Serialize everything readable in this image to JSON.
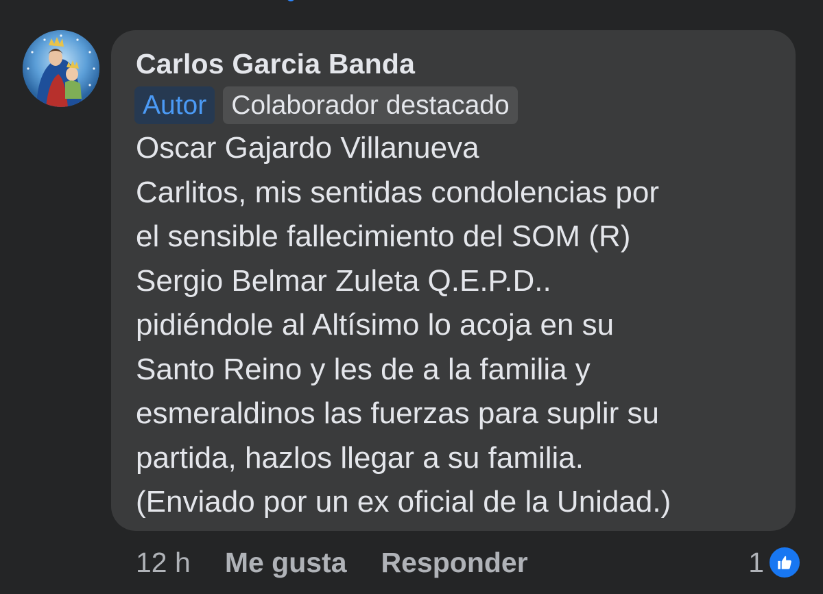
{
  "comment": {
    "author": "Carlos Garcia Banda",
    "badges": [
      "Autor",
      "Colaborador destacado"
    ],
    "lines": [
      "Oscar Gajardo Villanueva",
      "Carlitos, mis sentidas condolencias por",
      "el sensible fallecimiento del SOM (R)",
      "Sergio Belmar Zuleta Q.E.P.D..",
      "pidiéndole al Altísimo lo acoja en su",
      "Santo Reino y les de a la familia y",
      "esmeraldinos las fuerzas para suplir su",
      "partida, hazlos llegar a su familia.",
      "(Enviado por un ex oficial de la Unidad.)"
    ],
    "actions": {
      "time": "12 h",
      "like_label": "Me gusta",
      "reply_label": "Responder"
    },
    "reactions": {
      "count": "1",
      "icon": "thumbs-up-icon",
      "color": "#1877f2"
    }
  }
}
